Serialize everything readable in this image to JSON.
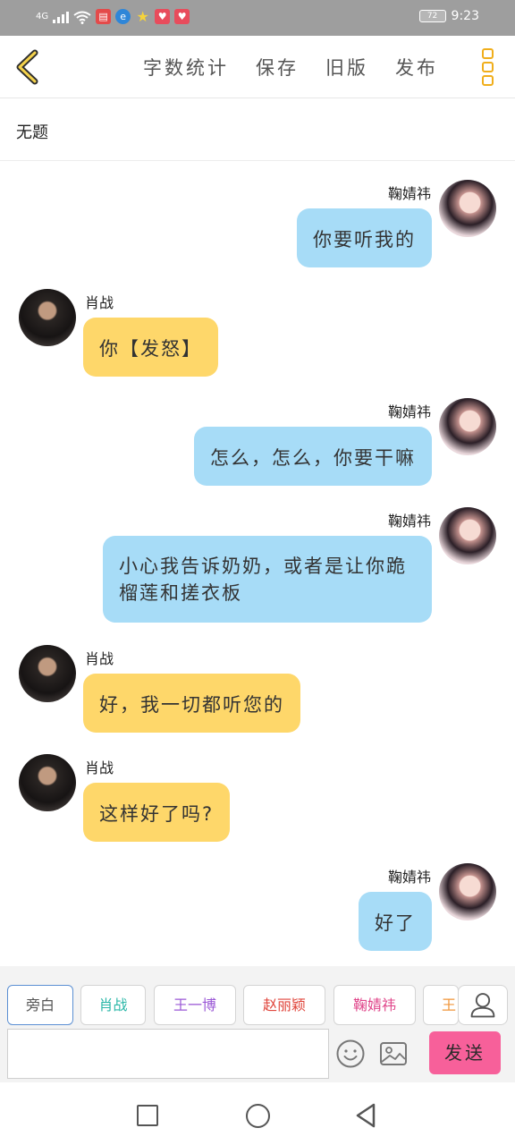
{
  "status_bar": {
    "network": "4G",
    "battery": "72",
    "time": "9:23",
    "icons": [
      "signal-icon",
      "wifi-icon",
      "book-app-icon",
      "browser-app-icon",
      "star-app-icon",
      "heart-app-icon",
      "heart-app-icon-2"
    ]
  },
  "toolbar": {
    "back_icon": "chevron-left-icon",
    "word_count": "字数统计",
    "save": "保存",
    "old_version": "旧版",
    "publish": "发布",
    "more_icon": "more-vertical-icon",
    "accent_color": "#f0ae1b"
  },
  "document": {
    "title": "无题"
  },
  "messages": [
    {
      "sender": "鞠婧祎",
      "side": "right",
      "text": "你要听我的",
      "color": "#a7dcf7"
    },
    {
      "sender": "肖战",
      "side": "left",
      "text": "你【发怒】",
      "color": "#fed76a"
    },
    {
      "sender": "鞠婧祎",
      "side": "right",
      "text": "怎么，怎么，你要干嘛",
      "color": "#a7dcf7"
    },
    {
      "sender": "鞠婧祎",
      "side": "right",
      "text": "小心我告诉奶奶，或者是让你跪榴莲和搓衣板",
      "color": "#a7dcf7"
    },
    {
      "sender": "肖战",
      "side": "left",
      "text": "好，我一切都听您的",
      "color": "#fed76a"
    },
    {
      "sender": "肖战",
      "side": "left",
      "text": "这样好了吗?",
      "color": "#fed76a"
    },
    {
      "sender": "鞠婧祎",
      "side": "right",
      "text": "好了",
      "color": "#a7dcf7"
    }
  ],
  "characters": [
    {
      "label": "旁白",
      "color": "#555555",
      "active": true
    },
    {
      "label": "肖战",
      "color": "#2bb7a8"
    },
    {
      "label": "王一博",
      "color": "#9b59d6"
    },
    {
      "label": "赵丽颖",
      "color": "#e0463c"
    },
    {
      "label": "鞠婧祎",
      "color": "#e0458a"
    },
    {
      "label": "王",
      "color": "#f0953a"
    }
  ],
  "input": {
    "placeholder": "",
    "emoji_icon": "emoji-icon",
    "image_icon": "image-icon",
    "person_icon": "person-icon",
    "send": "发送",
    "send_color": "#f7609a"
  },
  "nav": {
    "icons": [
      "recent-apps-icon",
      "home-icon",
      "back-icon"
    ]
  }
}
